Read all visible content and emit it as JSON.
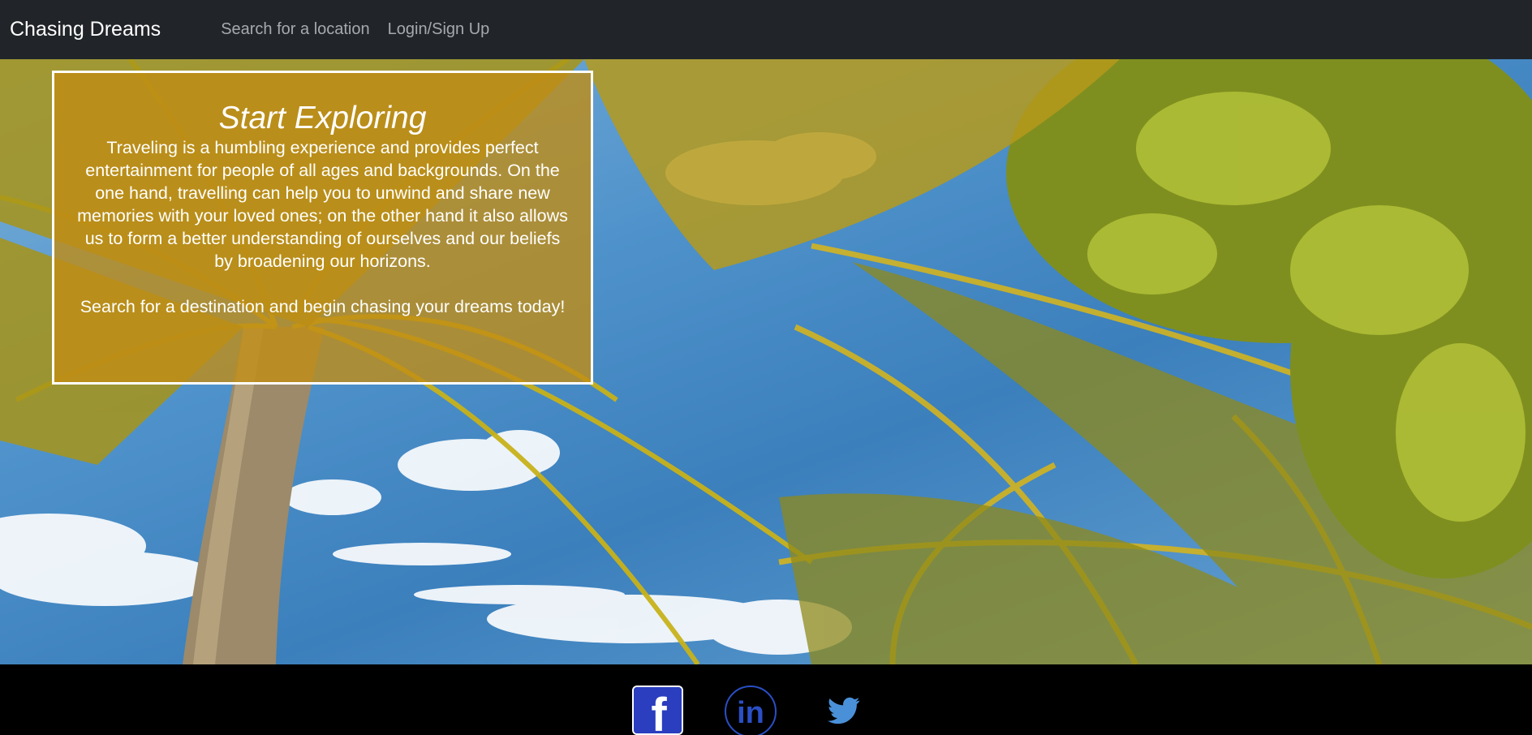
{
  "navbar": {
    "brand": "Chasing Dreams",
    "links": [
      "Search for a location",
      "Login/Sign Up"
    ]
  },
  "card": {
    "title": "Start Exploring",
    "body": "Traveling is a humbling experience and provides perfect entertainment for people of all ages and backgrounds. On the one hand, travelling can help you to unwind and share new memories with your loved ones; on the other hand it also allows us to form a better understanding of ourselves and our beliefs by broadening our horizons.",
    "cta": "Search for a destination and begin chasing your dreams today!"
  },
  "footer": {
    "social": [
      {
        "name": "facebook",
        "icon": "facebook-icon",
        "glyph": "f"
      },
      {
        "name": "linkedin",
        "icon": "linkedin-icon",
        "glyph": "in"
      },
      {
        "name": "twitter",
        "icon": "twitter-icon"
      }
    ]
  },
  "colors": {
    "navbar": "#212529",
    "brand_text": "#ffffff",
    "nav_link": "#a6a9ad",
    "card_tint": "#c08c14",
    "facebook_blue": "#2a3ebf",
    "linkedin_blue": "#2a4fc5",
    "twitter_blue": "#4a90d9",
    "footer": "#000000"
  }
}
